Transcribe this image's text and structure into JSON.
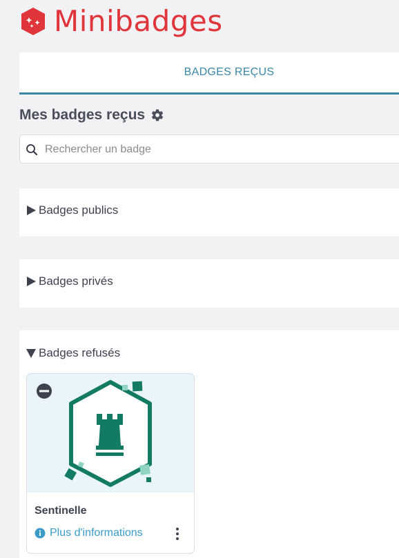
{
  "app": {
    "brand_name": "Minibadges"
  },
  "tabs": [
    {
      "label": "BADGES REÇUS",
      "active": true
    }
  ],
  "page": {
    "title": "Mes badges reçus"
  },
  "search": {
    "placeholder": "Rechercher un badge",
    "value": ""
  },
  "sections": {
    "public": {
      "label": "Badges publics",
      "expanded": false
    },
    "private": {
      "label": "Badges privés",
      "expanded": false
    },
    "refused": {
      "label": "Badges refusés",
      "expanded": true
    }
  },
  "badges": [
    {
      "title": "Sentinelle",
      "more_info_label": "Plus d'informations",
      "status_icon": "minus-circle-icon",
      "emblem_icon": "rook-icon"
    }
  ],
  "colors": {
    "brand_red": "#e0353a",
    "accent_blue": "#3a86a8",
    "link_blue": "#3a9bc9",
    "badge_green": "#137a63",
    "badge_bg": "#eaf5fb"
  }
}
